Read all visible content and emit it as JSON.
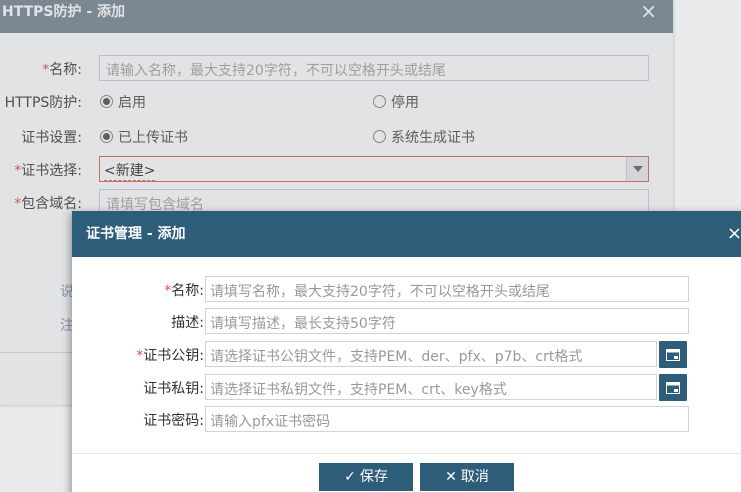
{
  "bg": {
    "title": "HTTPS防护 - 添加",
    "close": "×",
    "name_label": "名称:",
    "name_placeholder": "请输入名称，最大支持20字符，不可以空格开头或结尾",
    "https_label": "HTTPS防护:",
    "https_on": "启用",
    "https_off": "停用",
    "cert_setting_label": "证书设置:",
    "cert_uploaded": "已上传证书",
    "cert_generated": "系统生成证书",
    "cert_select_label": "证书选择:",
    "cert_select_value": "<新建>",
    "domain_label": "包含域名:",
    "domain_placeholder": "请填写包含域名",
    "side_text_1": "说",
    "side_text_2": "注"
  },
  "dialog": {
    "title": "证书管理 - 添加",
    "close": "×",
    "name_label": "名称:",
    "name_placeholder": "请填写名称，最大支持20字符，不可以空格开头或结尾",
    "desc_label": "描述:",
    "desc_placeholder": "请填写描述，最长支持50字符",
    "pubkey_label": "证书公钥:",
    "pubkey_placeholder": "请选择证书公钥文件，支持PEM、der、pfx、p7b、crt格式",
    "privkey_label": "证书私钥:",
    "privkey_placeholder": "请选择证书私钥文件，支持PEM、crt、key格式",
    "password_label": "证书密码:",
    "password_placeholder": "请输入pfx证书密码",
    "save": "保存",
    "cancel": "取消",
    "req_mark": "*"
  },
  "colors": {
    "dialog_header": "#2e5d7a",
    "bg_header": "#7d8b97",
    "required": "#d9534f"
  },
  "icons": {
    "file_browse": "folder-icon",
    "save": "check-icon",
    "cancel": "x-icon"
  }
}
